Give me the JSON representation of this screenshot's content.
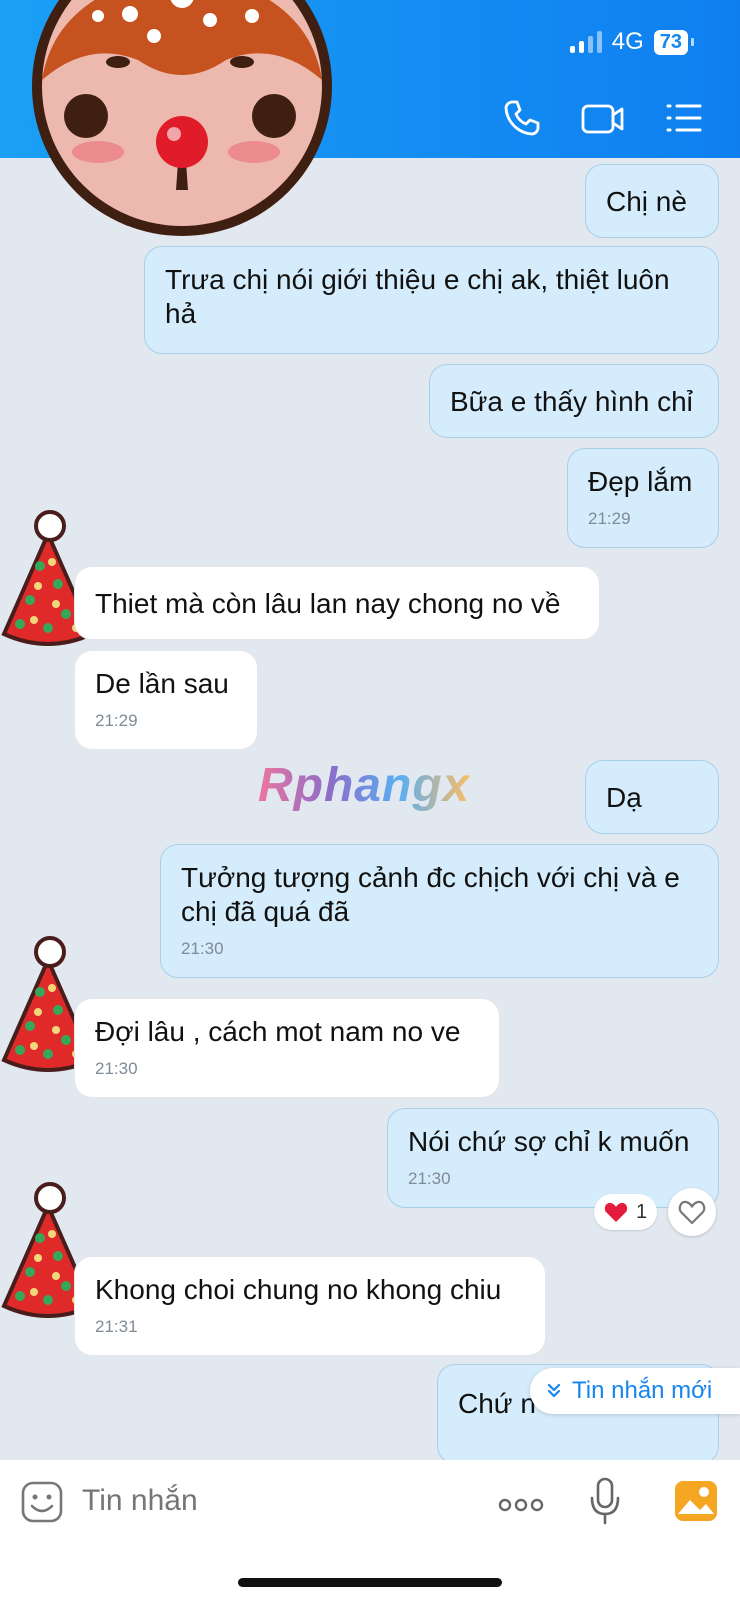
{
  "status": {
    "network": "4G",
    "battery": "73"
  },
  "header": {
    "icons": [
      "phone-icon",
      "video-call-icon",
      "menu-list-icon"
    ]
  },
  "watermark": "Rphangx",
  "messages": [
    {
      "side": "sent",
      "text": "Chị nè",
      "time": ""
    },
    {
      "side": "sent",
      "text": "Trưa chị nói giới thiệu e chị ak, thiệt luôn hả",
      "time": ""
    },
    {
      "side": "sent",
      "text": "Bữa e thấy hình chỉ",
      "time": ""
    },
    {
      "side": "sent",
      "text": "Đẹp lắm",
      "time": "21:29"
    },
    {
      "side": "received",
      "text": "Thiet mà còn lâu lan nay chong no về",
      "time": ""
    },
    {
      "side": "received",
      "text": "De lần sau",
      "time": "21:29"
    },
    {
      "side": "sent",
      "text": "Dạ",
      "time": ""
    },
    {
      "side": "sent",
      "text": "Tưởng tượng cảnh đc chịch với chị và e chị đã quá đã",
      "time": "21:30"
    },
    {
      "side": "received",
      "text": "Đợi lâu , cách mot nam no ve",
      "time": "21:30"
    },
    {
      "side": "sent",
      "text": "Nói chứ sợ chỉ k muốn",
      "time": "21:30"
    },
    {
      "side": "received",
      "text": "Khong choi chung no khong chiu",
      "time": "21:31"
    },
    {
      "side": "sent",
      "text": "Chứ n",
      "time": ""
    }
  ],
  "reaction": {
    "icon": "heart-icon",
    "count": "1"
  },
  "new_messages_label": "Tin nhắn mới",
  "input": {
    "placeholder": "Tin nhắn"
  },
  "colors": {
    "header": "#1488ef",
    "sent_bubble": "#d4ecfb",
    "received_bubble": "#ffffff",
    "background": "#e2e8f0"
  }
}
